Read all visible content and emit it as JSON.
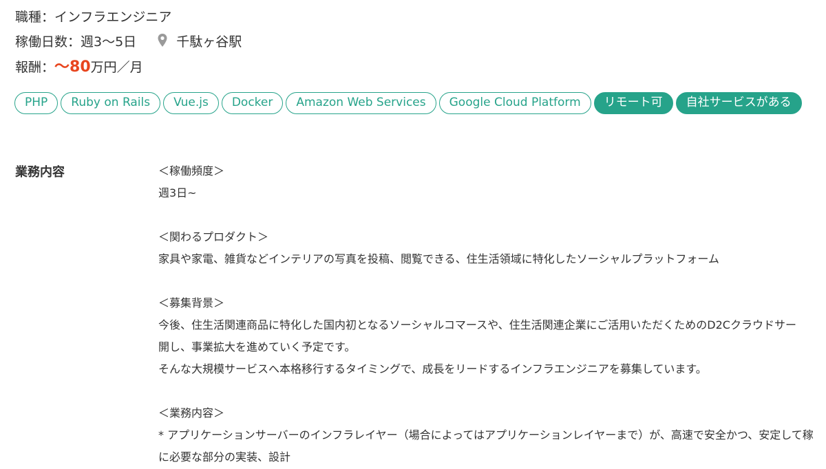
{
  "summary": {
    "job_type": "職種：インフラエンジニア",
    "work_days": "稼働日数：週3〜5日",
    "station": "千駄ヶ谷駅",
    "pay_label": "報酬：",
    "pay_prefix": "〜",
    "pay_amount": "80",
    "pay_unit": "万円／月"
  },
  "tags": {
    "skills": [
      "PHP",
      "Ruby on Rails",
      "Vue.js",
      "Docker",
      "Amazon Web Services",
      "Google Cloud Platform"
    ],
    "features": [
      "リモート可",
      "自社サービスがある"
    ]
  },
  "details": {
    "label": "業務内容",
    "frequency_heading": "＜稼働頻度＞",
    "frequency_text": "週3日~",
    "product_heading": "＜関わるプロダクト＞",
    "product_text": "家具や家電、雑貨などインテリアの写真を投稿、閲覧できる、住生活領域に特化したソーシャルプラットフォーム",
    "background_heading": "＜募集背景＞",
    "background_line1": "今後、住生活関連商品に特化した国内初となるソーシャルコマースや、住生活関連企業にご活用いただくためのD2Cクラウドサー",
    "background_line2": "開し、事業拡大を進めていく予定です。",
    "background_line3": "そんな大規模サービスへ本格移行するタイミングで、成長をリードするインフラエンジニアを募集しています。",
    "work_heading": "＜業務内容＞",
    "work_line1": "* アプリケーションサーバーのインフラレイヤー（場合によってはアプリケーションレイヤーまで）が、高速で安全かつ、安定して稼",
    "work_line2": "に必要な部分の実装、設計"
  },
  "colors": {
    "accent": "#26a38a",
    "pay": "#e8451e",
    "text": "#333333"
  },
  "icons": {
    "location": "map-pin-icon"
  }
}
